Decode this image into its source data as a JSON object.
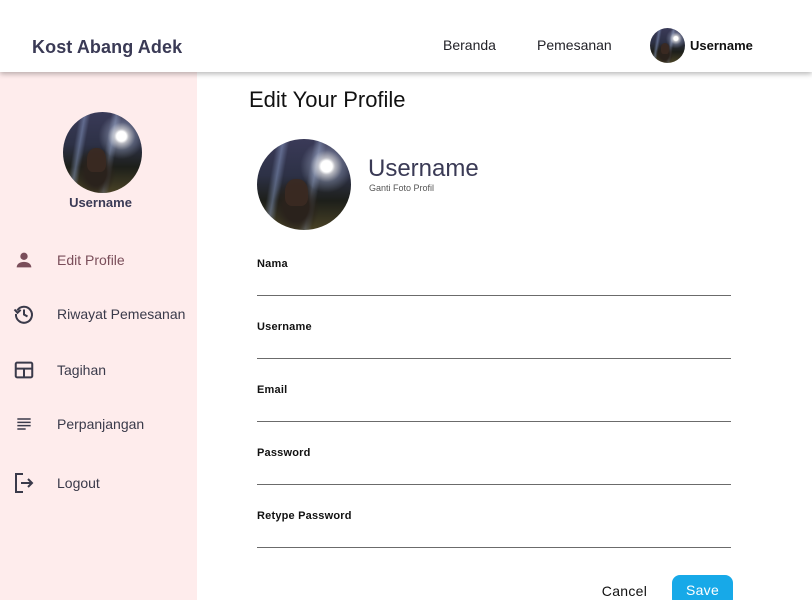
{
  "header": {
    "brand": "Kost Abang Adek",
    "nav": {
      "beranda": "Beranda",
      "pemesanan": "Pemesanan",
      "username": "Username"
    }
  },
  "sidebar": {
    "username": "Username",
    "items": [
      {
        "label": "Edit Profile",
        "icon": "person-icon"
      },
      {
        "label": "Riwayat Pemesanan",
        "icon": "history-icon"
      },
      {
        "label": "Tagihan",
        "icon": "table-icon"
      },
      {
        "label": "Perpanjangan",
        "icon": "list-lines-icon"
      },
      {
        "label": "Logout",
        "icon": "logout-icon"
      }
    ]
  },
  "main": {
    "title": "Edit Your Profile",
    "profile_name": "Username",
    "change_photo": "Ganti Foto Profil",
    "fields": [
      {
        "label": "Nama",
        "value": ""
      },
      {
        "label": "Username",
        "value": ""
      },
      {
        "label": "Email",
        "value": ""
      },
      {
        "label": "Password",
        "value": ""
      },
      {
        "label": "Retype Password",
        "value": ""
      }
    ],
    "actions": {
      "cancel": "Cancel",
      "save": "Save"
    }
  },
  "colors": {
    "sidebar_bg": "#feecec",
    "accent": "#17a9e8",
    "brand_text": "#3a3a55",
    "active_item": "#7a4e5a"
  }
}
